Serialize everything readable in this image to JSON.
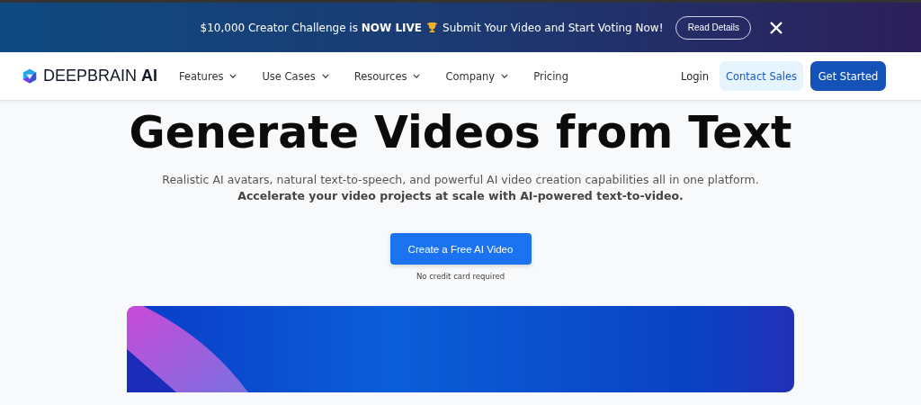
{
  "announcement": {
    "text_before": "$10,000 Creator Challenge is **NOW LIVE**",
    "text_after": "Submit Your Video and Start Voting Now!",
    "button": "Read Details"
  },
  "nav": {
    "logo": "DEEPBRAIN **AI**",
    "items": [
      {
        "label": "Features",
        "has_dropdown": true
      },
      {
        "label": "Use Cases",
        "has_dropdown": true
      },
      {
        "label": "Resources",
        "has_dropdown": true
      },
      {
        "label": "Company",
        "has_dropdown": true
      },
      {
        "label": "Pricing",
        "has_dropdown": false
      }
    ],
    "login": "Login",
    "contact": "Contact Sales",
    "cta": "Get Started"
  },
  "hero": {
    "title": "Generate Videos from Text",
    "subtitle": "Realistic AI avatars, natural text-to-speech, and powerful AI video creation capabilities all in one platform.",
    "subtitle_bold": "Accelerate your video projects at scale with AI-powered text-to-video.",
    "button": "Create a Free AI Video",
    "note": "No credit card required"
  }
}
